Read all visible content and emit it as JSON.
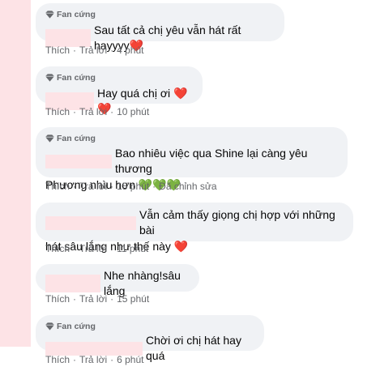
{
  "comments": [
    {
      "badge": "Fan cứng",
      "text": "Sau tất cả chị yêu vẫn hát rất hayyyy❤️",
      "actions": {
        "like": "Thích",
        "reply": "Trả lời",
        "time": "4 phút"
      }
    },
    {
      "badge": "Fan cứng",
      "text": "Hay quá chị ơi ❤️❤️",
      "actions": {
        "like": "Thích",
        "reply": "Trả lời",
        "time": "10 phút"
      }
    },
    {
      "badge": "Fan cứng",
      "text_line1": "Bao nhiêu việc qua Shine lại càng yêu thương",
      "text_line2": "Phương nhìu hơn 💚💚💚",
      "actions": {
        "like": "Thích",
        "reply": "Trả lời",
        "time": "15 phút",
        "edited": "Đã chỉnh sửa"
      }
    },
    {
      "text_line1": "Vẫn cảm thấy giọng chị hợp với những bài",
      "text_line2": "hát sâu lắng như thế này ❤️",
      "actions": {
        "like": "Thích",
        "reply": "Trả lời",
        "time": "11 phút"
      }
    },
    {
      "text": "Nhe nhàng!sâu lắng",
      "actions": {
        "like": "Thích",
        "reply": "Trả lời",
        "time": "15 phút"
      }
    },
    {
      "badge": "Fan cứng",
      "text": "Chời ơi chị hát hay quá",
      "actions": {
        "like": "Thích",
        "reply": "Trả lời",
        "time": "6 phút"
      }
    }
  ],
  "icons": {
    "badge": "gem-icon"
  },
  "colors": {
    "bubble": "#f0f2f5",
    "redaction": "#fde3e6",
    "meta": "#65676b"
  }
}
